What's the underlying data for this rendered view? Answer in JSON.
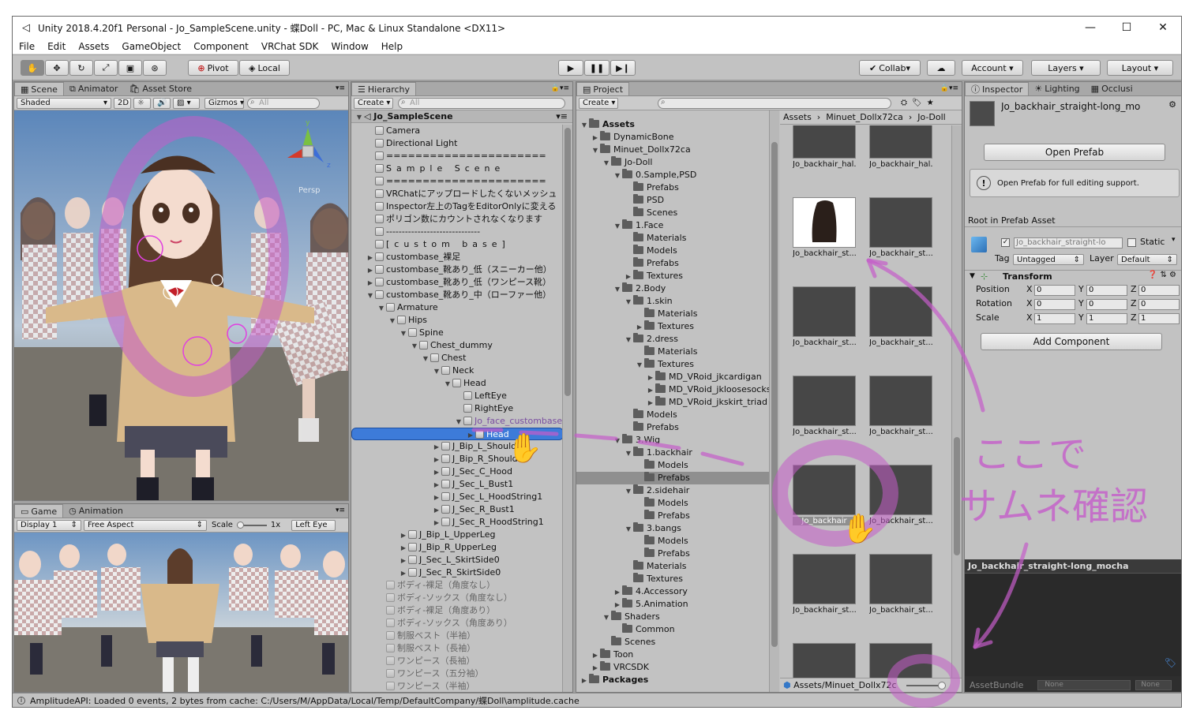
{
  "window": {
    "title": "Unity 2018.4.20f1 Personal - Jo_SampleScene.unity - 蝶Doll - PC, Mac & Linux Standalone <DX11>"
  },
  "menu": [
    "File",
    "Edit",
    "Assets",
    "GameObject",
    "Component",
    "VRChat SDK",
    "Window",
    "Help"
  ],
  "toolbar": {
    "pivot": "Pivot",
    "local": "Local",
    "collab": "Collab",
    "account": "Account",
    "layers": "Layers",
    "layout": "Layout"
  },
  "scene": {
    "tabs": [
      "Scene",
      "Animator",
      "Asset Store"
    ],
    "shaded": "Shaded",
    "mode2d": "2D",
    "gizmos": "Gizmos",
    "search": "All",
    "persp": "Persp"
  },
  "game": {
    "tabs": [
      "Game",
      "Animation"
    ],
    "display": "Display 1",
    "aspect": "Free Aspect",
    "scale_label": "Scale",
    "scale_value": "1x",
    "eye": "Left Eye"
  },
  "hierarchy": {
    "tab": "Hierarchy",
    "create": "Create",
    "search": "All",
    "scene": "Jo_SampleScene",
    "rows": [
      {
        "t": "Camera",
        "d": 1
      },
      {
        "t": "Directional Light",
        "d": 1
      },
      {
        "t": "======================",
        "d": 1
      },
      {
        "t": "Sample Scene",
        "d": 1,
        "c": true
      },
      {
        "t": "======================",
        "d": 1
      },
      {
        "t": "VRChatにアップロードしたくないメッシュ",
        "d": 1
      },
      {
        "t": "Inspector左上のTagをEditorOnlyに変える",
        "d": 1
      },
      {
        "t": "ポリゴン数にカウントされなくなります",
        "d": 1
      },
      {
        "t": "------------------------------",
        "d": 1
      },
      {
        "t": "[custom base]",
        "d": 1,
        "c": true
      },
      {
        "t": "custombase_裸足",
        "d": 1,
        "a": "r"
      },
      {
        "t": "custombase_靴あり_低（スニーカー他）",
        "d": 1,
        "a": "r"
      },
      {
        "t": "custombase_靴あり_低（ワンピース靴）",
        "d": 1,
        "a": "r"
      },
      {
        "t": "custombase_靴あり_中（ローファー他）",
        "d": 1,
        "a": "d"
      },
      {
        "t": "Armature",
        "d": 2,
        "a": "d"
      },
      {
        "t": "Hips",
        "d": 3,
        "a": "d"
      },
      {
        "t": "Spine",
        "d": 4,
        "a": "d"
      },
      {
        "t": "Chest_dummy",
        "d": 5,
        "a": "d"
      },
      {
        "t": "Chest",
        "d": 6,
        "a": "d"
      },
      {
        "t": "Neck",
        "d": 7,
        "a": "d"
      },
      {
        "t": "Head",
        "d": 8,
        "a": "d"
      },
      {
        "t": "LeftEye",
        "d": 9
      },
      {
        "t": "RightEye",
        "d": 9
      },
      {
        "t": "Jo_face_custombase",
        "d": 9,
        "a": "d",
        "p": true
      },
      {
        "t": "Head",
        "d": 10,
        "a": "r",
        "sel": true
      },
      {
        "t": "J_Bip_L_Shoulder",
        "d": 7,
        "a": "r"
      },
      {
        "t": "J_Bip_R_Shoulder",
        "d": 7,
        "a": "r"
      },
      {
        "t": "J_Sec_C_Hood",
        "d": 7,
        "a": "r"
      },
      {
        "t": "J_Sec_L_Bust1",
        "d": 7,
        "a": "r"
      },
      {
        "t": "J_Sec_L_HoodString1",
        "d": 7,
        "a": "r"
      },
      {
        "t": "J_Sec_R_Bust1",
        "d": 7,
        "a": "r"
      },
      {
        "t": "J_Sec_R_HoodString1",
        "d": 7,
        "a": "r"
      },
      {
        "t": "J_Bip_L_UpperLeg",
        "d": 4,
        "a": "r"
      },
      {
        "t": "J_Bip_R_UpperLeg",
        "d": 4,
        "a": "r"
      },
      {
        "t": "J_Sec_L_SkirtSide0",
        "d": 4,
        "a": "r"
      },
      {
        "t": "J_Sec_R_SkirtSide0",
        "d": 4,
        "a": "r"
      },
      {
        "t": "ボディ-裸足（角度なし）",
        "d": 2,
        "g": true
      },
      {
        "t": "ボディ-ソックス（角度なし）",
        "d": 2,
        "g": true
      },
      {
        "t": "ボディ-裸足（角度あり）",
        "d": 2,
        "g": true
      },
      {
        "t": "ボディ-ソックス（角度あり）",
        "d": 2,
        "g": true
      },
      {
        "t": "制服ベスト（半袖）",
        "d": 2,
        "g": true
      },
      {
        "t": "制服ベスト（長袖）",
        "d": 2,
        "g": true
      },
      {
        "t": "ワンピース（長袖）",
        "d": 2,
        "g": true
      },
      {
        "t": "ワンピース（五分袖）",
        "d": 2,
        "g": true
      },
      {
        "t": "ワンピース（半袖）",
        "d": 2,
        "g": true
      }
    ]
  },
  "project": {
    "tab": "Project",
    "create": "Create",
    "breadcrumb": [
      "Assets",
      "Minuet_Dollx72ca",
      "Jo-Doll"
    ],
    "tree": [
      {
        "t": "Assets",
        "d": 0,
        "a": "d",
        "b": true
      },
      {
        "t": "DynamicBone",
        "d": 1,
        "a": "r"
      },
      {
        "t": "Minuet_Dollx72ca",
        "d": 1,
        "a": "d"
      },
      {
        "t": "Jo-Doll",
        "d": 2,
        "a": "d"
      },
      {
        "t": "0.Sample,PSD",
        "d": 3,
        "a": "d"
      },
      {
        "t": "Prefabs",
        "d": 4
      },
      {
        "t": "PSD",
        "d": 4
      },
      {
        "t": "Scenes",
        "d": 4
      },
      {
        "t": "1.Face",
        "d": 3,
        "a": "d"
      },
      {
        "t": "Materials",
        "d": 4
      },
      {
        "t": "Models",
        "d": 4
      },
      {
        "t": "Prefabs",
        "d": 4
      },
      {
        "t": "Textures",
        "d": 4,
        "a": "r"
      },
      {
        "t": "2.Body",
        "d": 3,
        "a": "d"
      },
      {
        "t": "1.skin",
        "d": 4,
        "a": "d"
      },
      {
        "t": "Materials",
        "d": 5
      },
      {
        "t": "Textures",
        "d": 5,
        "a": "r"
      },
      {
        "t": "2.dress",
        "d": 4,
        "a": "d"
      },
      {
        "t": "Materials",
        "d": 5
      },
      {
        "t": "Textures",
        "d": 5,
        "a": "d"
      },
      {
        "t": "MD_VRoid_jkcardigan",
        "d": 6,
        "a": "r"
      },
      {
        "t": "MD_VRoid_jkloosesocks",
        "d": 6,
        "a": "r"
      },
      {
        "t": "MD_VRoid_jkskirt_triad",
        "d": 6,
        "a": "r"
      },
      {
        "t": "Models",
        "d": 4
      },
      {
        "t": "Prefabs",
        "d": 4
      },
      {
        "t": "3.Wig",
        "d": 3,
        "a": "d"
      },
      {
        "t": "1.backhair",
        "d": 4,
        "a": "d"
      },
      {
        "t": "Models",
        "d": 5
      },
      {
        "t": "Prefabs",
        "d": 5,
        "sel": true
      },
      {
        "t": "2.sidehair",
        "d": 4,
        "a": "d"
      },
      {
        "t": "Models",
        "d": 5
      },
      {
        "t": "Prefabs",
        "d": 5
      },
      {
        "t": "3.bangs",
        "d": 4,
        "a": "d"
      },
      {
        "t": "Models",
        "d": 5
      },
      {
        "t": "Prefabs",
        "d": 5
      },
      {
        "t": "Materials",
        "d": 4
      },
      {
        "t": "Textures",
        "d": 4
      },
      {
        "t": "4.Accessory",
        "d": 3,
        "a": "r"
      },
      {
        "t": "5.Animation",
        "d": 3,
        "a": "r"
      },
      {
        "t": "Shaders",
        "d": 2,
        "a": "d"
      },
      {
        "t": "Common",
        "d": 3
      },
      {
        "t": "Scenes",
        "d": 2
      },
      {
        "t": "Toon",
        "d": 1,
        "a": "r"
      },
      {
        "t": "VRCSDK",
        "d": 1,
        "a": "r"
      },
      {
        "t": "Packages",
        "d": 0,
        "a": "r",
        "b": true
      }
    ],
    "tiles": [
      "Jo_backhair_hal...",
      "Jo_backhair_hal...",
      "Jo_backhair_st...",
      "Jo_backhair_st...",
      "Jo_backhair_st...",
      "Jo_backhair_st...",
      "Jo_backhair_st...",
      "Jo_backhair_st...",
      "Jo_backhair",
      "Jo_backhair_st...",
      "Jo_backhair_st...",
      "Jo_backhair_st...",
      "",
      ""
    ],
    "bottom_path": "Assets/Minuet_Dollx72c"
  },
  "inspector": {
    "tabs": [
      "Inspector",
      "Lighting",
      "Occlusi"
    ],
    "title": "Jo_backhair_straight-long_mo",
    "open_prefab": "Open Prefab",
    "help": "Open Prefab for full editing support.",
    "root_label": "Root in Prefab Asset",
    "name": "Jo_backhair_straight-lo",
    "static": "Static",
    "tag_label": "Tag",
    "tag": "Untagged",
    "layer_label": "Layer",
    "layer": "Default",
    "transform": "Transform",
    "position": "Position",
    "rotation": "Rotation",
    "scale": "Scale",
    "pos": [
      "0",
      "0",
      "0"
    ],
    "rot": [
      "0",
      "0",
      "0"
    ],
    "scl": [
      "1",
      "1",
      "1"
    ],
    "add_component": "Add Component",
    "preview_title": "Jo_backhair_straight-long_mocha",
    "assetbundle": "AssetBundle",
    "none1": "None",
    "none2": "None"
  },
  "status": "AmplitudeAPI: Loaded 0 events, 2 bytes from cache: C:/Users/M/AppData/Local/Temp/DefaultCompany/蝶Doll\\amplitude.cache",
  "annotation": {
    "text": "ここでサムネ確認",
    "line1": "ここで",
    "line2": "サムネ確認"
  },
  "colors": {
    "annotation": "#c45cc9",
    "selection": "#3d7bd9"
  }
}
